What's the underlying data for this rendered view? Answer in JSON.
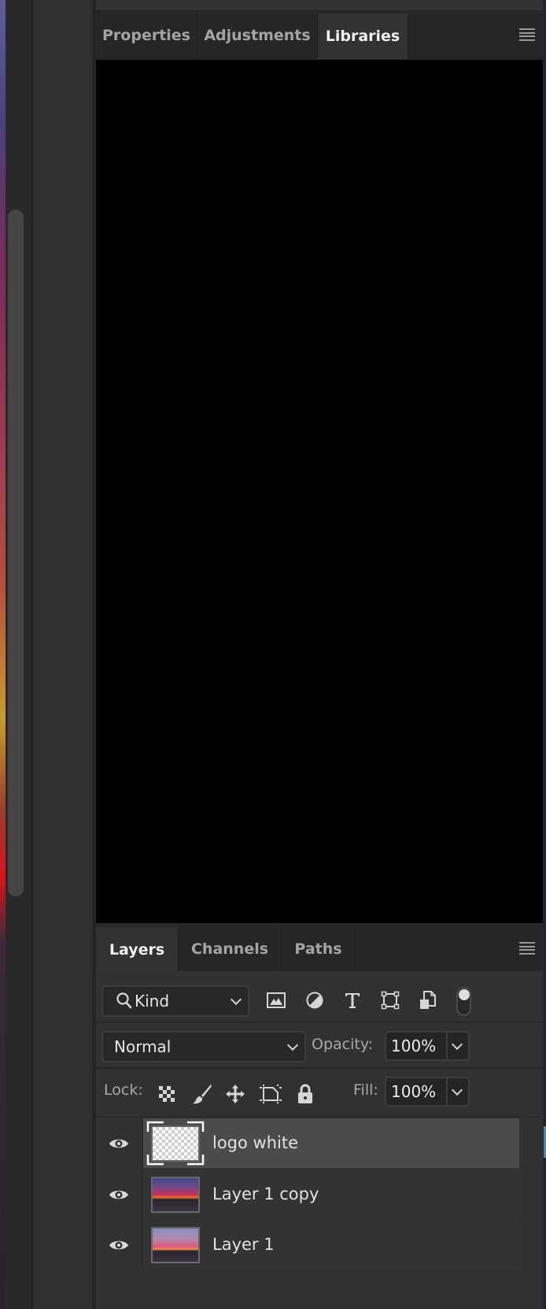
{
  "properties_panel": {
    "tabs": [
      {
        "label": "Properties",
        "active": false
      },
      {
        "label": "Adjustments",
        "active": false
      },
      {
        "label": "Libraries",
        "active": true
      }
    ],
    "menu_icon": "panel-menu-icon"
  },
  "layers_panel": {
    "tabs": [
      {
        "label": "Layers",
        "active": true
      },
      {
        "label": "Channels",
        "active": false
      },
      {
        "label": "Paths",
        "active": false
      }
    ],
    "menu_icon": "panel-menu-icon",
    "filter": {
      "icon": "search-icon",
      "value": "Kind",
      "filter_icons": [
        "pixel-layer-filter-icon",
        "adjustment-layer-filter-icon",
        "type-layer-filter-icon",
        "shape-layer-filter-icon",
        "smart-object-filter-icon"
      ],
      "toggle_on": false
    },
    "blend_mode": "Normal",
    "opacity_label": "Opacity:",
    "opacity_value": "100%",
    "lock_label": "Lock:",
    "lock_icons": [
      "lock-transparent-pixels-icon",
      "lock-image-pixels-icon",
      "lock-position-icon",
      "lock-artboard-icon",
      "lock-all-icon"
    ],
    "fill_label": "Fill:",
    "fill_value": "100%",
    "layers": [
      {
        "name": "logo white",
        "visible": true,
        "selected": true,
        "thumbnail": "transparent"
      },
      {
        "name": "Layer 1 copy",
        "visible": true,
        "selected": false,
        "thumbnail": "sunset-road-saturated"
      },
      {
        "name": "Layer 1",
        "visible": true,
        "selected": false,
        "thumbnail": "sunset-road"
      }
    ]
  }
}
